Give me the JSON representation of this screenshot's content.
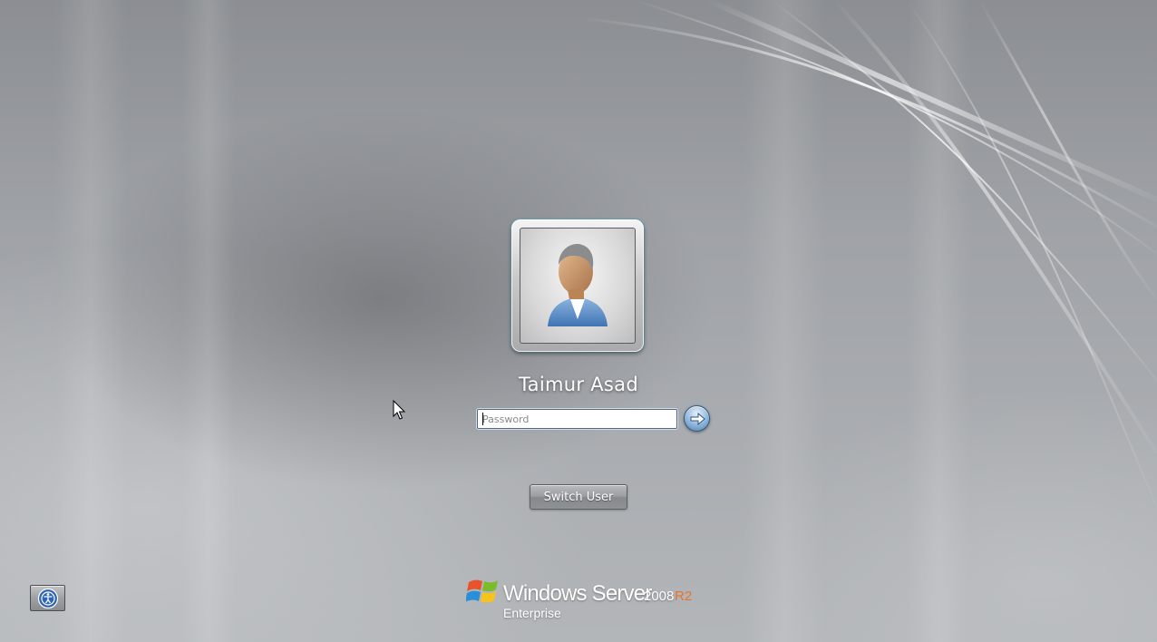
{
  "user": {
    "name": "Taimur Asad"
  },
  "login": {
    "password_placeholder": "Password",
    "password_value": "",
    "submit_icon": "arrow-right-icon"
  },
  "actions": {
    "switch_user_label": "Switch User"
  },
  "ease_of_access": {
    "icon": "ease-of-access-icon"
  },
  "branding": {
    "product": "Windows Server",
    "version": "2008",
    "release": "R2",
    "edition": "Enterprise",
    "logo_icon": "windows-flag-icon"
  },
  "colors": {
    "accent_release": "#e8742a",
    "go_button": "#4d7fb0",
    "background": "#a0a3a7"
  }
}
